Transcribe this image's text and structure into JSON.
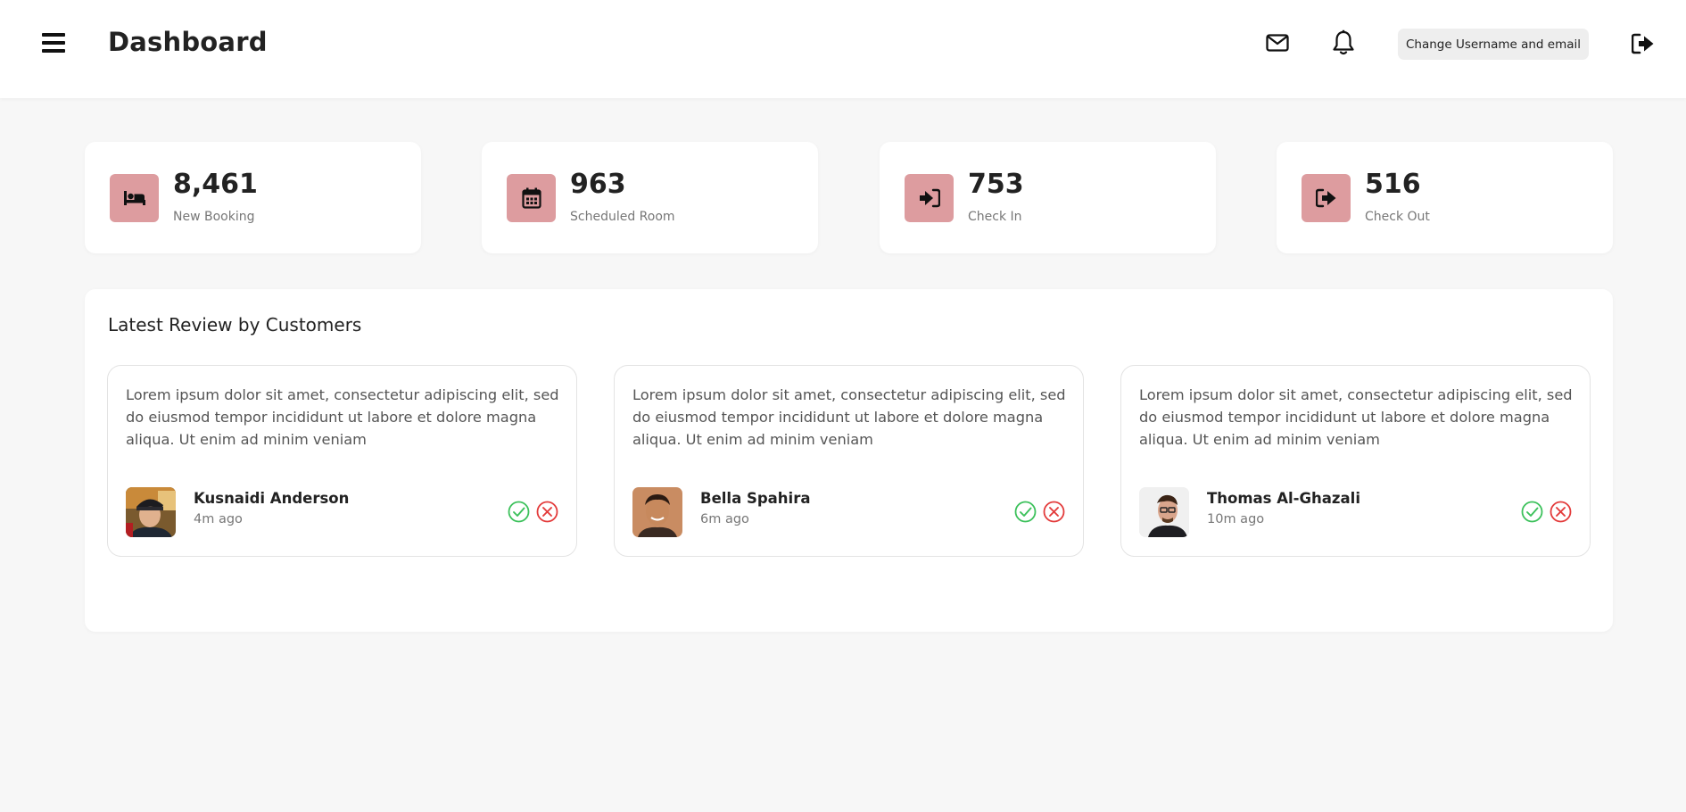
{
  "header": {
    "title": "Dashboard",
    "menu_icon": "hamburger-menu-icon",
    "mail_icon": "envelope-icon",
    "bell_icon": "bell-icon",
    "account_button_label": "Change Username and email",
    "logout_icon": "sign-out-icon"
  },
  "stats": [
    {
      "value": "8,461",
      "label": "New Booking",
      "icon": "bed-icon"
    },
    {
      "value": "963",
      "label": "Scheduled Room",
      "icon": "calendar-icon"
    },
    {
      "value": "753",
      "label": "Check In",
      "icon": "sign-in-icon"
    },
    {
      "value": "516",
      "label": "Check Out",
      "icon": "sign-out-icon"
    }
  ],
  "reviews": {
    "title": "Latest Review by Customers",
    "items": [
      {
        "text": "Lorem ipsum dolor sit amet, consectetur adipiscing elit, sed do eiusmod tempor incididunt ut labore et dolore magna aliqua. Ut enim ad minim veniam",
        "name": "Kusnaidi Anderson",
        "time": "4m ago"
      },
      {
        "text": "Lorem ipsum dolor sit amet, consectetur adipiscing elit, sed do eiusmod tempor incididunt ut labore et dolore magna aliqua. Ut enim ad minim veniam",
        "name": "Bella Spahira",
        "time": "6m ago"
      },
      {
        "text": "Lorem ipsum dolor sit amet, consectetur adipiscing elit, sed do eiusmod tempor incididunt ut labore et dolore magna aliqua. Ut enim ad minim veniam",
        "name": "Thomas Al-Ghazali",
        "time": "10m ago"
      }
    ]
  },
  "colors": {
    "accent": "#dd9c9f",
    "approve": "#3cc15b",
    "reject": "#e33b3b",
    "background": "#f7f7f7",
    "card": "#ffffff"
  }
}
